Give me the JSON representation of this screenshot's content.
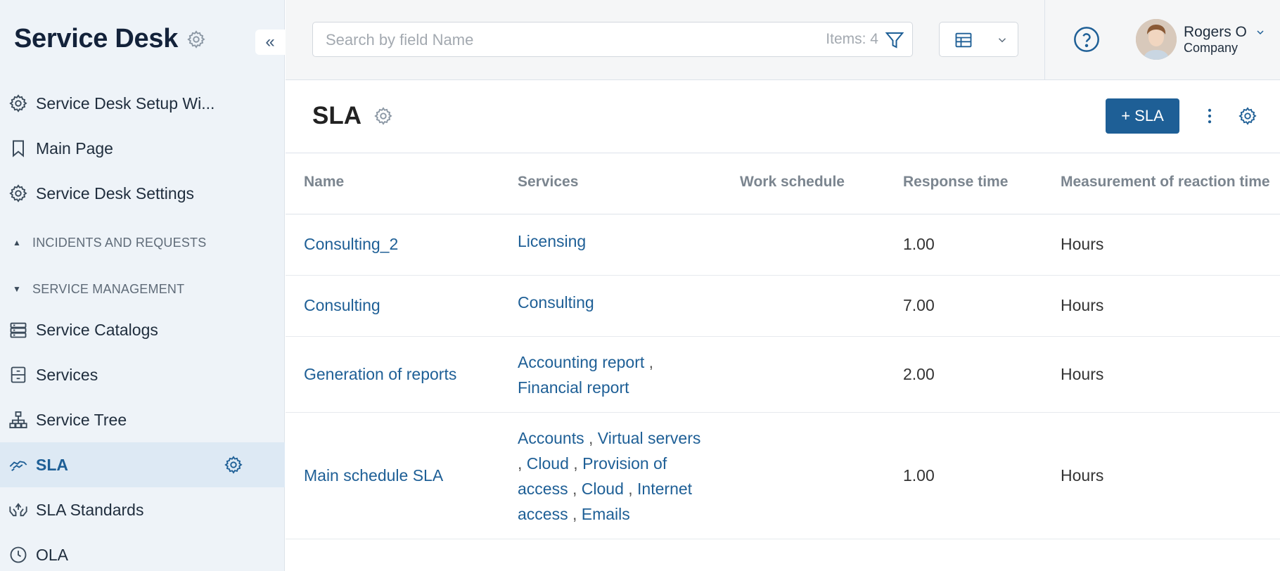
{
  "sidebar": {
    "title": "Service Desk",
    "items_top": [
      {
        "label": "Service Desk Setup Wi...",
        "icon": "gear-icon"
      },
      {
        "label": "Main Page",
        "icon": "bookmark-icon"
      },
      {
        "label": "Service Desk Settings",
        "icon": "gear-icon"
      }
    ],
    "sections": [
      {
        "label": "INCIDENTS AND REQUESTS",
        "state": "collapsed"
      },
      {
        "label": "SERVICE MANAGEMENT",
        "state": "expanded"
      }
    ],
    "items_bottom": [
      {
        "label": "Service Catalogs",
        "icon": "catalog-icon"
      },
      {
        "label": "Services",
        "icon": "archive-icon"
      },
      {
        "label": "Service Tree",
        "icon": "tree-icon"
      },
      {
        "label": "SLA",
        "icon": "handshake-icon",
        "active": true
      },
      {
        "label": "SLA Standards",
        "icon": "hands-icon"
      },
      {
        "label": "OLA",
        "icon": "clock-icon"
      }
    ]
  },
  "topbar": {
    "search_placeholder": "Search by field Name",
    "items_count": "Items: 4",
    "user_name": "Rogers O",
    "user_company": "Company"
  },
  "page": {
    "title": "SLA",
    "add_button": "+ SLA"
  },
  "table": {
    "headers": {
      "name": "Name",
      "services": "Services",
      "work_schedule": "Work schedule",
      "response_time": "Response time",
      "measurement": "Measurement of reaction time"
    },
    "rows": [
      {
        "name": "Consulting_2",
        "services": [
          "Licensing"
        ],
        "work_schedule": "",
        "response_time": "1.00",
        "measurement": "Hours"
      },
      {
        "name": "Consulting",
        "services": [
          "Consulting"
        ],
        "work_schedule": "",
        "response_time": "7.00",
        "measurement": "Hours"
      },
      {
        "name": "Generation of reports",
        "services": [
          "Accounting report",
          "Financial report"
        ],
        "work_schedule": "",
        "response_time": "2.00",
        "measurement": "Hours"
      },
      {
        "name": "Main schedule SLA",
        "services": [
          "Accounts",
          "Virtual servers",
          "Cloud",
          "Provision of access",
          "Cloud",
          "Internet access",
          "Emails"
        ],
        "work_schedule": "",
        "response_time": "1.00",
        "measurement": "Hours"
      }
    ]
  },
  "colors": {
    "accent": "#1e5f96",
    "sidebar_bg": "#eef3f8",
    "active_item_bg": "#dde9f4"
  }
}
